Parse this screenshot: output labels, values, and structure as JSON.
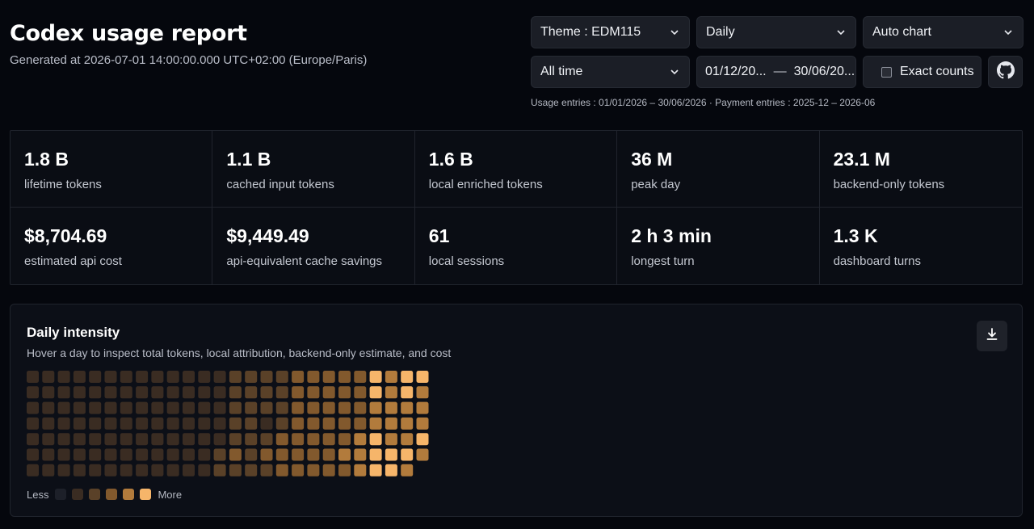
{
  "header": {
    "title": "Codex usage report",
    "generated": "Generated at 2026-07-01 14:00:00.000 UTC+02:00 (Europe/Paris)"
  },
  "controls": {
    "theme": "Theme : EDM115",
    "granularity": "Daily",
    "chart_mode": "Auto chart",
    "range": "All time",
    "date_from": "01/12/20...",
    "date_sep": "—",
    "date_to": "30/06/20...",
    "exact_counts_label": "Exact counts",
    "exact_counts_checked": false,
    "github_icon": "github-icon"
  },
  "entries_note": "Usage entries : 01/01/2026 – 30/06/2026 · Payment entries : 2025-12 – 2026-06",
  "stats": [
    {
      "value": "1.8 B",
      "label": "lifetime tokens"
    },
    {
      "value": "1.1 B",
      "label": "cached input tokens"
    },
    {
      "value": "1.6 B",
      "label": "local enriched tokens"
    },
    {
      "value": "36 M",
      "label": "peak day"
    },
    {
      "value": "23.1 M",
      "label": "backend-only tokens"
    },
    {
      "value": "$8,704.69",
      "label": "estimated api cost"
    },
    {
      "value": "$9,449.49",
      "label": "api-equivalent cache savings"
    },
    {
      "value": "61",
      "label": "local sessions"
    },
    {
      "value": "2 h 3 min",
      "label": "longest turn"
    },
    {
      "value": "1.3 K",
      "label": "dashboard turns"
    }
  ],
  "intensity": {
    "title": "Daily intensity",
    "subtitle": "Hover a day to inspect total tokens, local attribution, backend-only estimate, and cost",
    "download_icon": "download-icon",
    "legend_less": "Less",
    "legend_more": "More",
    "palette": [
      "#1d2029",
      "#3a2c22",
      "#5a4128",
      "#82592d",
      "#b27b3c",
      "#f6b56a"
    ],
    "columns": [
      [
        1,
        1,
        1,
        1,
        1,
        1,
        1
      ],
      [
        1,
        1,
        1,
        1,
        1,
        1,
        1
      ],
      [
        1,
        1,
        1,
        1,
        1,
        1,
        1
      ],
      [
        1,
        1,
        1,
        1,
        1,
        1,
        1
      ],
      [
        1,
        1,
        1,
        1,
        1,
        1,
        1
      ],
      [
        1,
        1,
        1,
        1,
        1,
        1,
        1
      ],
      [
        1,
        1,
        1,
        1,
        1,
        1,
        1
      ],
      [
        1,
        1,
        1,
        1,
        1,
        1,
        1
      ],
      [
        1,
        1,
        1,
        1,
        1,
        1,
        1
      ],
      [
        1,
        1,
        1,
        1,
        1,
        1,
        1
      ],
      [
        1,
        1,
        1,
        1,
        1,
        1,
        1
      ],
      [
        1,
        1,
        1,
        1,
        1,
        1,
        1
      ],
      [
        1,
        1,
        1,
        1,
        1,
        2,
        2
      ],
      [
        2,
        2,
        2,
        2,
        2,
        3,
        2
      ],
      [
        2,
        2,
        2,
        2,
        2,
        2,
        2
      ],
      [
        2,
        2,
        2,
        1,
        2,
        3,
        2
      ],
      [
        2,
        2,
        2,
        2,
        3,
        3,
        3
      ],
      [
        3,
        3,
        3,
        3,
        3,
        3,
        3
      ],
      [
        3,
        3,
        3,
        3,
        3,
        3,
        3
      ],
      [
        3,
        3,
        3,
        3,
        3,
        3,
        3
      ],
      [
        3,
        3,
        3,
        3,
        3,
        4,
        3
      ],
      [
        3,
        3,
        3,
        3,
        4,
        4,
        4
      ],
      [
        5,
        5,
        4,
        4,
        5,
        5,
        5
      ],
      [
        4,
        4,
        4,
        4,
        4,
        5,
        5
      ],
      [
        5,
        5,
        4,
        4,
        4,
        5,
        4
      ],
      [
        5,
        4,
        4,
        4,
        5,
        4,
        null
      ]
    ]
  }
}
